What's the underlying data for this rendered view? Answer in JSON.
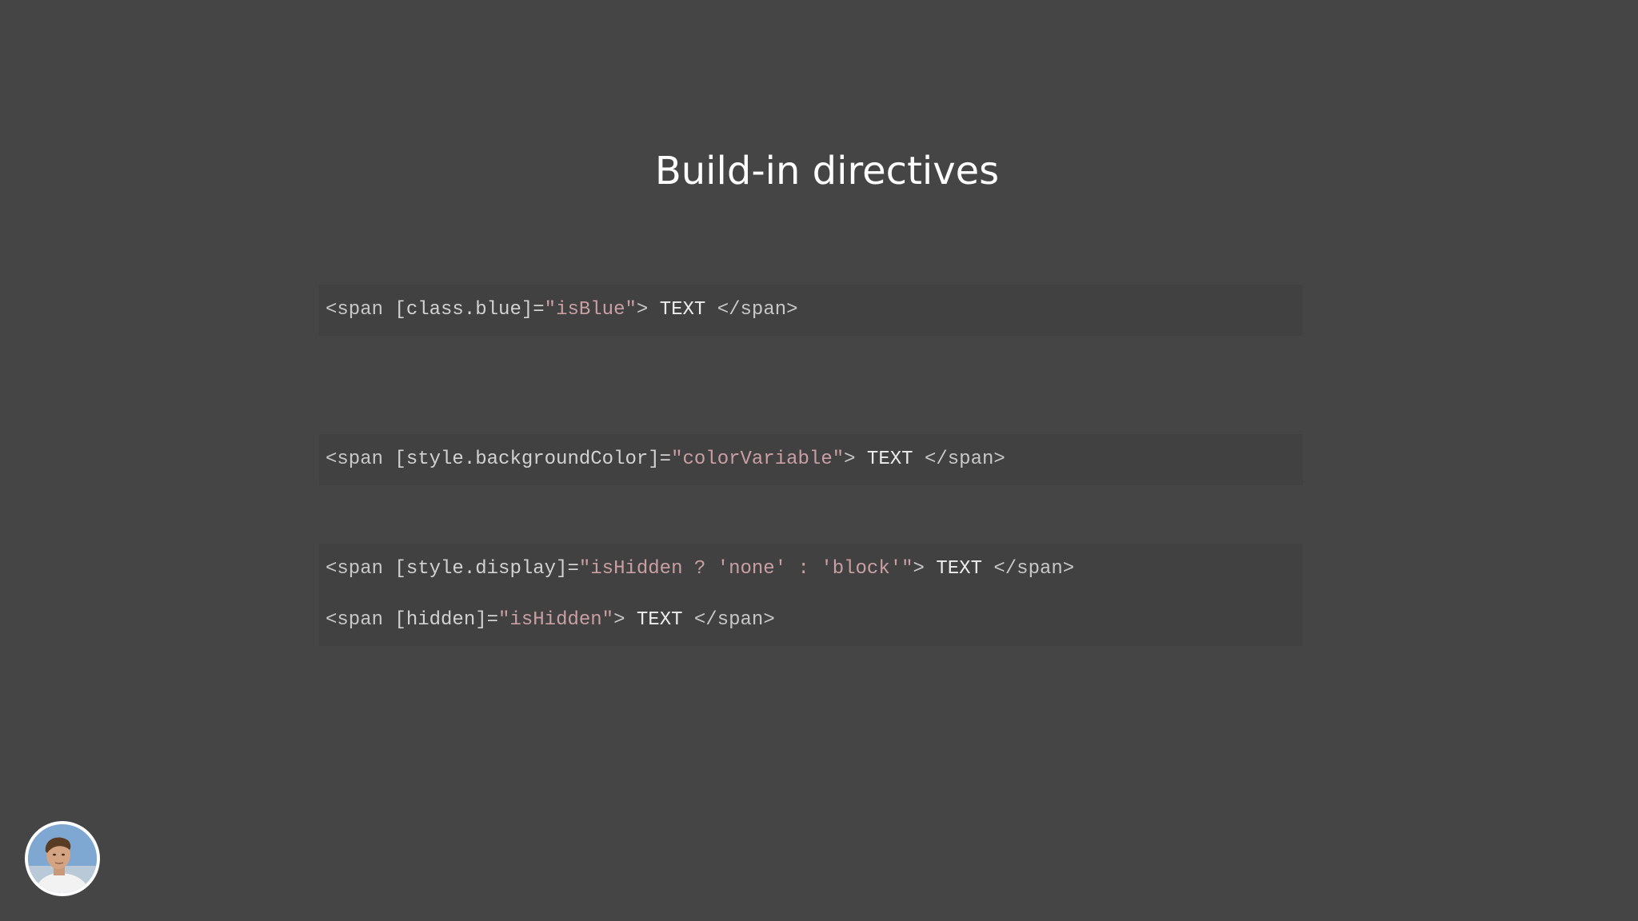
{
  "slide": {
    "title": "Build-in directives"
  },
  "code_blocks": [
    {
      "lines": [
        {
          "open_tag": "<span",
          "binding": " [class.blue]=",
          "q1": "\"",
          "expr": "isBlue",
          "q2": "\"",
          "close": ">",
          "text": " TEXT ",
          "end_tag": "</span>"
        }
      ]
    },
    {
      "lines": [
        {
          "open_tag": "<span",
          "binding": " [style.backgroundColor]=",
          "q1": "\"",
          "expr": "colorVariable",
          "q2": "\"",
          "close": ">",
          "text": " TEXT ",
          "end_tag": "</span>"
        }
      ]
    },
    {
      "lines": [
        {
          "open_tag": "<span",
          "binding": " [style.display]=",
          "q1": "\"",
          "expr": "isHidden ? 'none' : 'block'",
          "q2": "\"",
          "close": ">",
          "text": " TEXT ",
          "end_tag": "</span>"
        },
        {
          "open_tag": "<span",
          "binding": " [hidden]=",
          "q1": "\"",
          "expr": "isHidden",
          "q2": "\"",
          "close": ">",
          "text": " TEXT ",
          "end_tag": "</span>"
        }
      ]
    }
  ],
  "presenter": {
    "icon": "presenter-avatar"
  },
  "colors": {
    "background": "#464546",
    "code_background": "#424142",
    "tag": "#d8c9a4",
    "string": "#c99fa4",
    "text": "#ececec"
  }
}
